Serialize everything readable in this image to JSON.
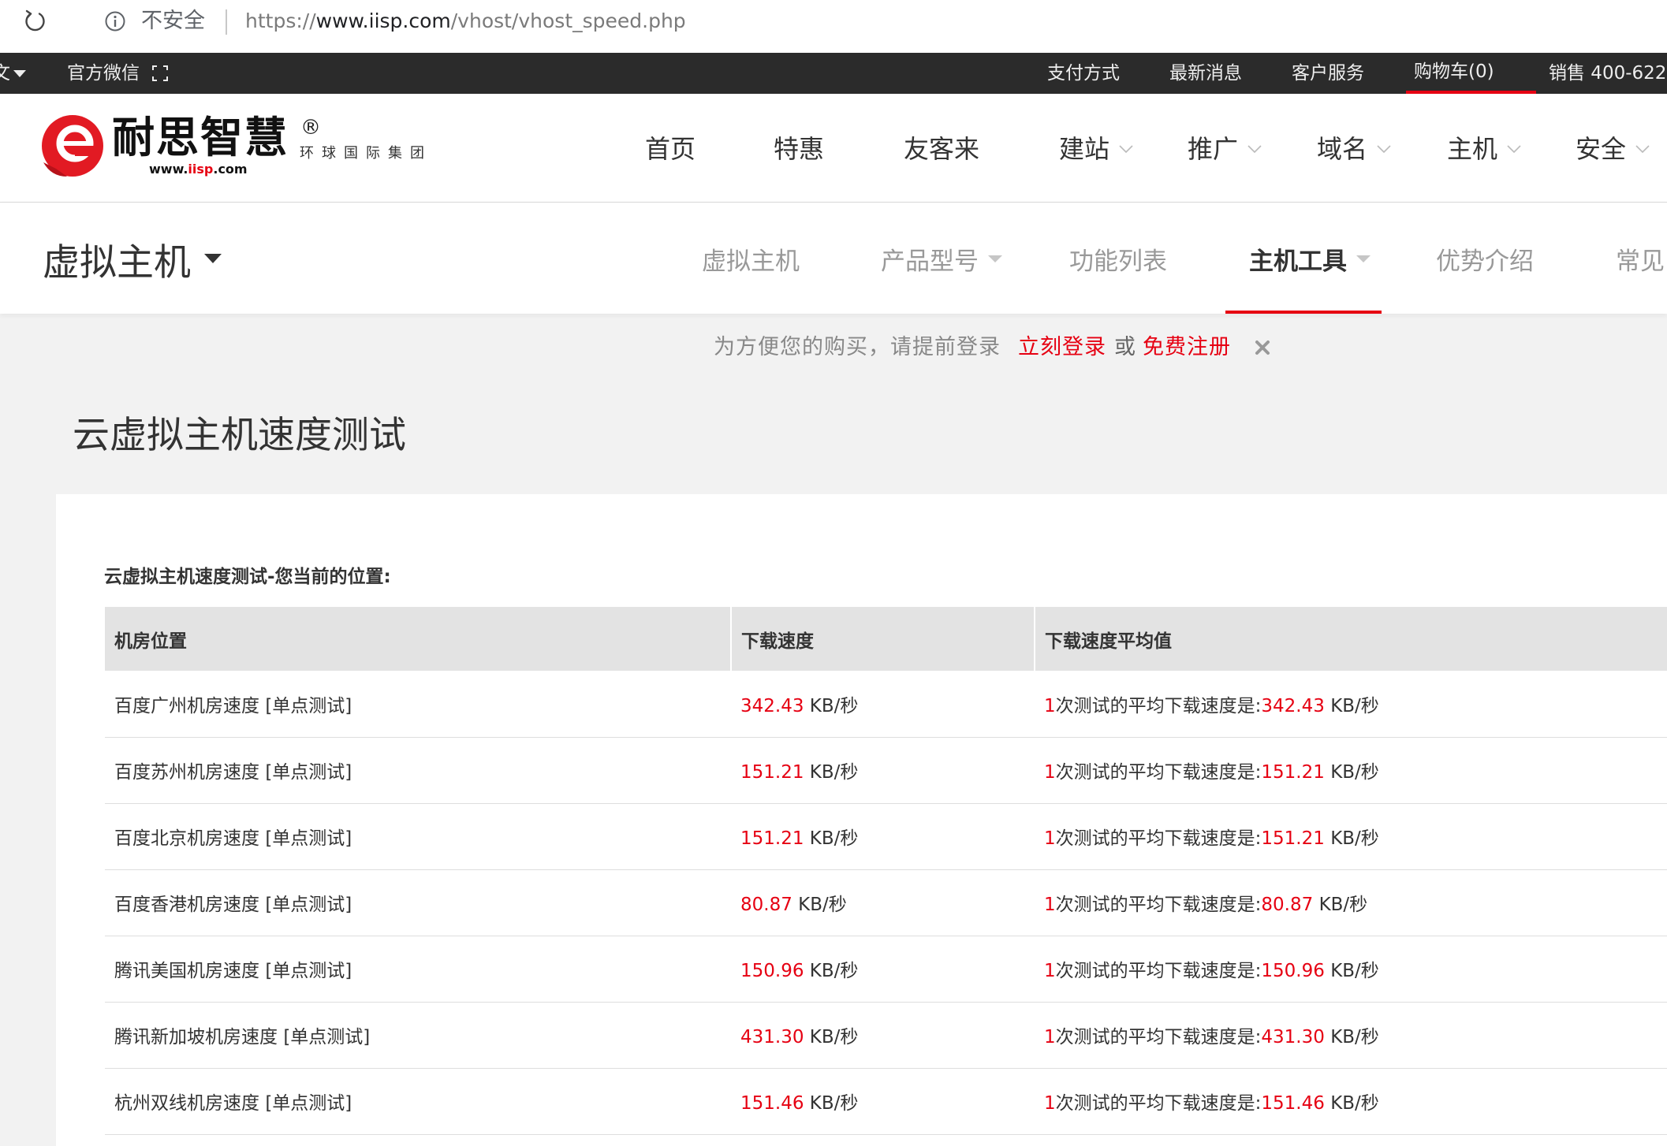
{
  "colors": {
    "accent": "#e60012",
    "topbar_bg": "#2b2b2b",
    "page_bg": "#f2f2f2",
    "table_header_bg": "#e3e3e3"
  },
  "browser": {
    "security_label": "不安全",
    "url_scheme": "https://",
    "url_host": "www.iisp.com",
    "url_path": "/vhost/vhost_speed.php"
  },
  "topbar": {
    "language": "文",
    "wechat": "官方微信",
    "payment": "支付方式",
    "news": "最新消息",
    "service": "客户服务",
    "cart": "购物车(0)",
    "sales": "销售 400-622"
  },
  "logo": {
    "brand": "耐思智慧",
    "registered": "®",
    "group": "环球国际集团",
    "domain_prefix": "www.",
    "domain_brand": "iisp",
    "domain_suffix": ".com"
  },
  "main_nav": [
    {
      "label": "首页"
    },
    {
      "label": "特惠"
    },
    {
      "label": "友客来"
    },
    {
      "label": "建站",
      "icon": "chevron-down-icon"
    },
    {
      "label": "推广",
      "icon": "chevron-down-icon"
    },
    {
      "label": "域名",
      "icon": "chevron-down-icon"
    },
    {
      "label": "主机",
      "icon": "chevron-down-icon"
    },
    {
      "label": "安全",
      "icon": "chevron-down-icon"
    }
  ],
  "section": {
    "title": "虚拟主机",
    "tabs": [
      {
        "label": "虚拟主机"
      },
      {
        "label": "产品型号",
        "icon": "caret-down-icon"
      },
      {
        "label": "功能列表"
      },
      {
        "label": "主机工具",
        "icon": "caret-down-icon",
        "active": true
      },
      {
        "label": "优势介绍"
      },
      {
        "label": "常见"
      }
    ]
  },
  "login_notice": {
    "text": "为方便您的购买，请提前登录",
    "login_link": "立刻登录",
    "or": "或",
    "register_link": "免费注册",
    "close_icon": "close-icon"
  },
  "page_title": "云虚拟主机速度测试",
  "location_label": "云虚拟主机速度测试-您当前的位置:",
  "table": {
    "headers": [
      "机房位置",
      "下载速度",
      "下载速度平均值"
    ],
    "rows": [
      {
        "location": "百度广州机房速度",
        "test_link": "[单点测试]",
        "speed": "342.43",
        "unit": "KB/秒",
        "avg_count": "1",
        "avg_label": "次测试的平均下载速度是:",
        "avg_speed": "342.43",
        "avg_unit": "KB/秒"
      },
      {
        "location": "百度苏州机房速度",
        "test_link": "[单点测试]",
        "speed": "151.21",
        "unit": "KB/秒",
        "avg_count": "1",
        "avg_label": "次测试的平均下载速度是:",
        "avg_speed": "151.21",
        "avg_unit": "KB/秒"
      },
      {
        "location": "百度北京机房速度",
        "test_link": "[单点测试]",
        "speed": "151.21",
        "unit": "KB/秒",
        "avg_count": "1",
        "avg_label": "次测试的平均下载速度是:",
        "avg_speed": "151.21",
        "avg_unit": "KB/秒"
      },
      {
        "location": "百度香港机房速度",
        "test_link": "[单点测试]",
        "speed": "80.87",
        "unit": "KB/秒",
        "avg_count": "1",
        "avg_label": "次测试的平均下载速度是:",
        "avg_speed": "80.87",
        "avg_unit": "KB/秒"
      },
      {
        "location": "腾讯美国机房速度",
        "test_link": "[单点测试]",
        "speed": "150.96",
        "unit": "KB/秒",
        "avg_count": "1",
        "avg_label": "次测试的平均下载速度是:",
        "avg_speed": "150.96",
        "avg_unit": "KB/秒"
      },
      {
        "location": "腾讯新加坡机房速度",
        "test_link": "[单点测试]",
        "speed": "431.30",
        "unit": "KB/秒",
        "avg_count": "1",
        "avg_label": "次测试的平均下载速度是:",
        "avg_speed": "431.30",
        "avg_unit": "KB/秒"
      },
      {
        "location": "杭州双线机房速度",
        "test_link": "[单点测试]",
        "speed": "151.46",
        "unit": "KB/秒",
        "avg_count": "1",
        "avg_label": "次测试的平均下载速度是:",
        "avg_speed": "151.46",
        "avg_unit": "KB/秒"
      }
    ]
  }
}
